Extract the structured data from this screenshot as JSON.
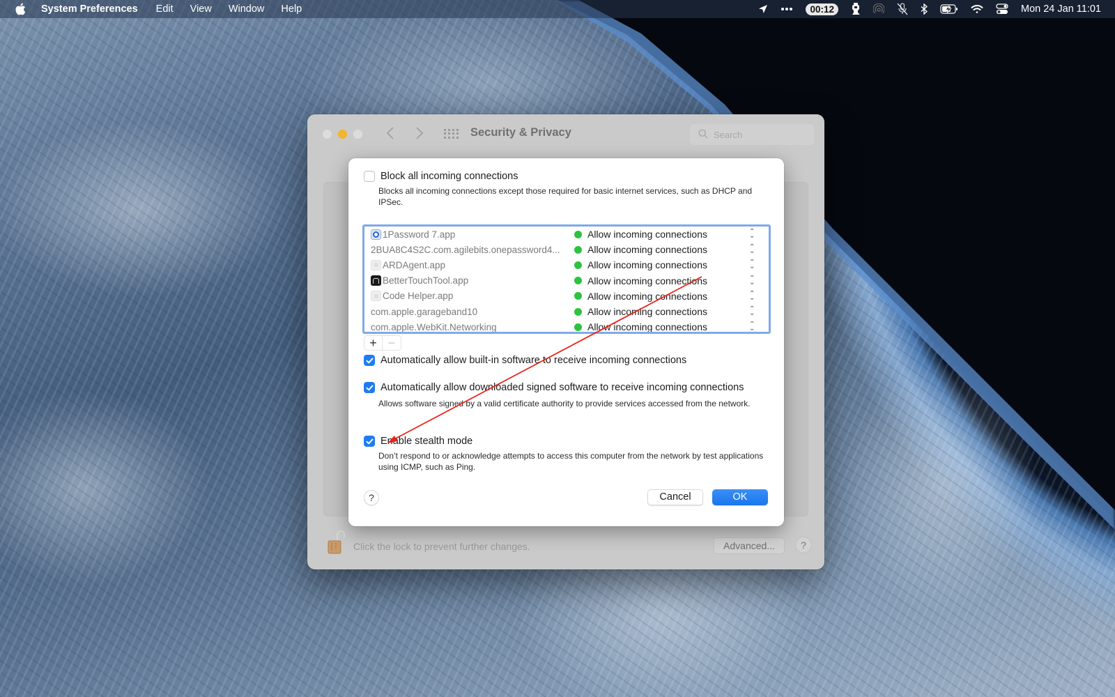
{
  "menubar": {
    "app_name": "System Preferences",
    "menus": [
      "Edit",
      "View",
      "Window",
      "Help"
    ],
    "status_icons": [
      "location-arrow-icon",
      "more-dots-icon",
      "timer-pill",
      "script-icon",
      "airdrop-icon",
      "mic-muted-icon",
      "bluetooth-icon",
      "battery-charging-icon",
      "wifi-icon",
      "control-center-icon"
    ],
    "timer": "00:12",
    "clock": "Mon 24 Jan  11:01"
  },
  "window": {
    "title": "Security & Privacy",
    "search_placeholder": "Search",
    "footer": {
      "lock_text": "Click the lock to prevent further changes.",
      "advanced_label": "Advanced...",
      "help_label": "?"
    }
  },
  "dialog": {
    "block_all": {
      "label": "Block all incoming connections",
      "checked": false,
      "description": "Blocks all incoming connections except those required for basic internet services, such as DHCP and IPSec."
    },
    "apps": [
      {
        "name": "1Password 7.app",
        "icon": "onepassword-icon",
        "status": "Allow incoming connections",
        "status_color": "#2cc33d"
      },
      {
        "name": "2BUA8C4S2C.com.agilebits.onepassword4...",
        "icon": "",
        "status": "Allow incoming connections",
        "status_color": "#2cc33d"
      },
      {
        "name": "ARDAgent.app",
        "icon": "generic-app-icon",
        "status": "Allow incoming connections",
        "status_color": "#2cc33d"
      },
      {
        "name": "BetterTouchTool.app",
        "icon": "bettertouchtool-icon",
        "status": "Allow incoming connections",
        "status_color": "#2cc33d"
      },
      {
        "name": "Code Helper.app",
        "icon": "generic-app-icon",
        "status": "Allow incoming connections",
        "status_color": "#2cc33d"
      },
      {
        "name": "com.apple.garageband10",
        "icon": "",
        "status": "Allow incoming connections",
        "status_color": "#2cc33d"
      },
      {
        "name": "com.apple.WebKit.Networking",
        "icon": "",
        "status": "Allow incoming connections",
        "status_color": "#2cc33d"
      }
    ],
    "add_label": "+",
    "remove_label": "−",
    "auto_builtin": {
      "label": "Automatically allow built-in software to receive incoming connections",
      "checked": true
    },
    "auto_signed": {
      "label": "Automatically allow downloaded signed software to receive incoming connections",
      "checked": true,
      "description": "Allows software signed by a valid certificate authority to provide services accessed from the network."
    },
    "stealth": {
      "label": "Enable stealth mode",
      "checked": true,
      "description": "Don’t respond to or acknowledge attempts to access this computer from the network by test applications using ICMP, such as Ping."
    },
    "help_label": "?",
    "cancel_label": "Cancel",
    "ok_label": "OK",
    "accent_color": "#1f7cf0"
  },
  "annotation": {
    "type": "arrow",
    "color": "#e8251b",
    "points_to": "stealth-mode-checkbox"
  }
}
